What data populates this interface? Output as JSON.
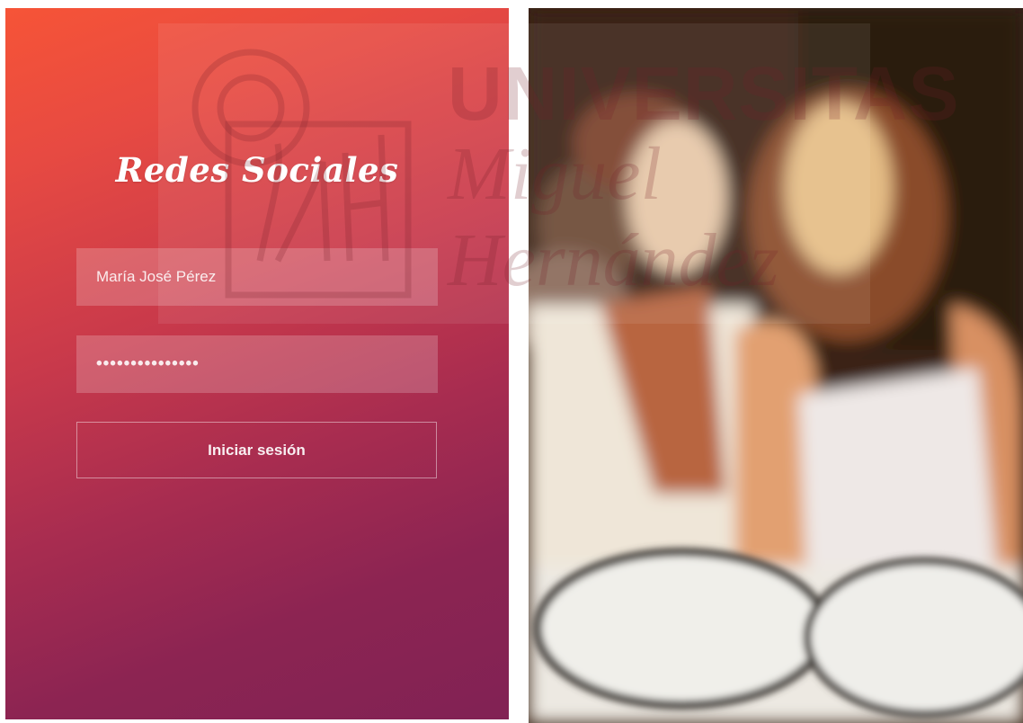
{
  "login": {
    "title": "Redes Sociales",
    "username_value": "María José Pérez",
    "password_mask": "•••••••••••••••",
    "submit_label": "Iniciar sesión"
  },
  "watermark": {
    "line1": "UNIVERSITAS",
    "line2": "Miguel",
    "line3": "Hernández"
  },
  "colors": {
    "gradient_top": "#f65437",
    "gradient_bottom": "#812254",
    "photo_background": "#3a2416"
  }
}
